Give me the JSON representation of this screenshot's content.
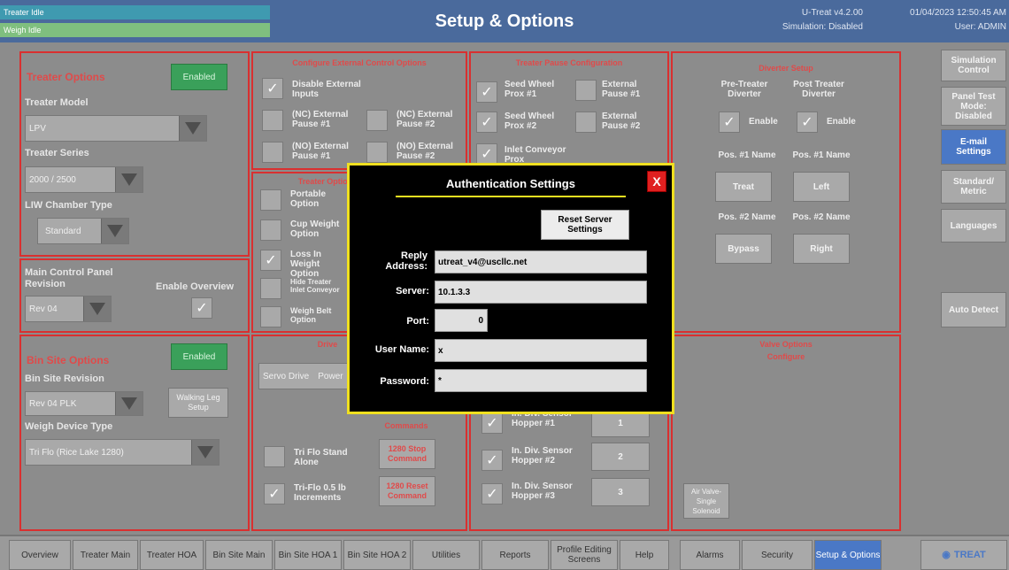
{
  "header": {
    "status_top": "Treater Idle",
    "status_bottom": "Weigh Idle",
    "title": "Setup & Options",
    "version": "U-Treat v4.2.00",
    "simulation": "Simulation: Disabled",
    "datetime": "01/04/2023 12:50:45 AM",
    "user": "User: ADMIN"
  },
  "treater_options": {
    "title": "Treater Options",
    "status": "Enabled",
    "model_label": "Treater Model",
    "model_value": "LPV",
    "series_label": "Treater Series",
    "series_value": "2000 / 2500",
    "liw_label": "LIW Chamber Type",
    "liw_value": "Standard"
  },
  "main_panel": {
    "revision_label": "Main Control Panel Revision",
    "revision_value": "Rev 04",
    "overview_label": "Enable Overview"
  },
  "bin_site": {
    "title": "Bin Site Options",
    "status": "Enabled",
    "revision_label": "Bin Site Revision",
    "revision_value": "Rev 04 PLK",
    "walking_leg": "Walking Leg Setup",
    "weigh_device_label": "Weigh Device Type",
    "weigh_device_value": "Tri Flo (Rice Lake 1280)"
  },
  "config_inputs": {
    "title": "Configure External Control Options",
    "disable": "Disable External Inputs",
    "nc_pause1": "(NC) External Pause #1",
    "nc_pause2": "(NC) External Pause #2",
    "no_pause1": "(NO) External Pause #1",
    "no_pause2": "(NO) External Pause #2"
  },
  "treater_options2": {
    "title": "Treater Options",
    "portable": "Portable Option",
    "cup_weight": "Cup Weight Option",
    "loss_in_weight": "Loss In Weight Option",
    "hide_treater": "Hide Treater Inlet Conveyor",
    "weigh_belt": "Weigh Belt Option"
  },
  "drive_panel": {
    "title": "Drive",
    "servo_drive": "Servo Drive",
    "power": "Power",
    "tri_flo_stand": "Tri Flo Stand Alone",
    "tri_flo_increments": "Tri-Flo 0.5 lb Increments",
    "stop_command": "1280 Stop Command",
    "reset_command": "1280 Reset Command",
    "commands_title": "Commands"
  },
  "treater_pause": {
    "title": "Treater Pause Configuration",
    "seed_wheel1": "Seed Wheel Prox #1",
    "seed_wheel2": "Seed Wheel Prox #2",
    "inlet_conveyor": "Inlet Conveyor Prox",
    "ext_pause1": "External Pause #1",
    "ext_pause2": "External Pause #2"
  },
  "hoppers": [
    {
      "label": "In. Div. Sensor Hopper #1",
      "num": "1"
    },
    {
      "label": "In. Div. Sensor Hopper #2",
      "num": "2"
    },
    {
      "label": "In. Div. Sensor Hopper #3",
      "num": "3"
    }
  ],
  "diverter": {
    "title": "Diverter Setup",
    "pre_label": "Pre-Treater Diverter",
    "post_label": "Post Treater Diverter",
    "enable": "Enable",
    "pos1_name": "Pos. #1 Name",
    "pos2_name": "Pos. #2 Name",
    "pre_pos1": "Treat",
    "post_pos1": "Left",
    "pre_pos2": "Bypass",
    "post_pos2": "Right"
  },
  "valve_panel": {
    "title": "Valve Options",
    "subtitle": "Configure",
    "air_valve": "Air Valve- Single Solenoid"
  },
  "side_menu": {
    "simulation": "Simulation Control",
    "panel_test": "Panel Test Mode: Disabled",
    "email": "E-mail Settings",
    "standard_metric": "Standard/ Metric",
    "languages": "Languages",
    "auto_detect": "Auto Detect"
  },
  "dialog": {
    "title": "Authentication Settings",
    "close": "X",
    "reset_button": "Reset Server Settings",
    "reply_label": "Reply Address:",
    "reply_value": "utreat_v4@uscllc.net",
    "server_label": "Server:",
    "server_value": "10.1.3.3",
    "port_label": "Port:",
    "port_value": "0",
    "username_label": "User Name:",
    "username_value": "x",
    "password_label": "Password:",
    "password_value": "*"
  },
  "nav": {
    "overview": "Overview",
    "treater_main": "Treater Main",
    "treater_hoa": "Treater HOA",
    "bin_site_main": "Bin Site Main",
    "bin_site_hoa1": "Bin Site HOA 1",
    "bin_site_hoa2": "Bin Site HOA 2",
    "utilities": "Utilities",
    "reports": "Reports",
    "profile_editing": "Profile Editing Screens",
    "help": "Help",
    "alarms": "Alarms",
    "security": "Security",
    "setup_options": "Setup & Options",
    "logo": "TREAT"
  },
  "colors": {
    "header": "#4a6a9c",
    "panel_border": "#d93030",
    "dialog_border": "#f0e020",
    "active_tab": "#4a78c6"
  }
}
